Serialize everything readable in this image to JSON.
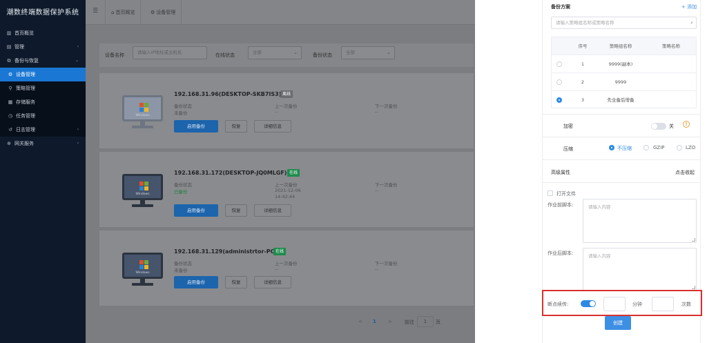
{
  "app": {
    "title": "潮数终端数据保护系统"
  },
  "sidebar": {
    "items": [
      {
        "label": "首页概览",
        "icon": "chart-icon"
      },
      {
        "label": "管理",
        "icon": "grid-icon"
      },
      {
        "label": "备份与恢复",
        "icon": "copy-icon"
      }
    ],
    "sub_items": [
      {
        "label": "设备管理",
        "icon": "gear-icon"
      },
      {
        "label": "策略管理",
        "icon": "strategy-icon"
      },
      {
        "label": "存储服务",
        "icon": "storage-icon"
      },
      {
        "label": "任务管理",
        "icon": "clock-icon"
      },
      {
        "label": "日志管理",
        "icon": "log-icon"
      }
    ],
    "gateway": {
      "label": "网关服务",
      "icon": "gateway-icon"
    }
  },
  "topbar": {
    "tabs": [
      {
        "label": "首页概览"
      },
      {
        "label": "设备管理"
      }
    ]
  },
  "filter": {
    "device_name_label": "设备名称",
    "device_name_placeholder": "请输入IP地址或主机名",
    "online_label": "在线状态",
    "online_value": "全部",
    "backup_label": "备份状态",
    "backup_value": "全部"
  },
  "devices": [
    {
      "title": "192.168.31.96(DESKTOP-SKB7IS3)",
      "status": "离线",
      "online": false,
      "backup_status_label": "备份状态",
      "backup_status": "未备份",
      "last_label": "上一次备份",
      "last_value": "--",
      "last_time": "",
      "next_label": "下一次备份",
      "next_value": "--"
    },
    {
      "title": "192.168.31.172(DESKTOP-JQ0MLGF)",
      "status": "在线",
      "online": true,
      "backup_status_label": "备份状态",
      "backup_status": "已备份",
      "last_label": "上一次备份",
      "last_value": "2021-12-06",
      "last_time": "14:42:44",
      "next_label": "下一次备份",
      "next_value": "--"
    },
    {
      "title": "192.168.31.129(administrtor-PC)",
      "status": "在线",
      "online": true,
      "backup_status_label": "备份状态",
      "backup_status": "未备份",
      "last_label": "上一次备份",
      "last_value": "--",
      "last_time": "",
      "next_label": "下一次备份",
      "next_value": "--"
    }
  ],
  "device_buttons": {
    "enable": "启用备份",
    "restore": "恢复",
    "details": "详细信息"
  },
  "monitor_text": "Windows",
  "pagination": {
    "current": "1",
    "goto_label": "前往",
    "goto_value": "1",
    "page_unit": "页",
    "prev": "<",
    "next": ">"
  },
  "panel": {
    "backup_plan_label": "备份方案",
    "add_link": "+ 添加",
    "search_placeholder": "请输入策略组名称或策略名称",
    "table": {
      "headers": [
        "序号",
        "策略组名称",
        "策略名称"
      ],
      "rows": [
        {
          "index": "1",
          "group": "9999(副本)",
          "name": "",
          "selected": false
        },
        {
          "index": "2",
          "group": "9999",
          "name": "",
          "selected": false
        },
        {
          "index": "3",
          "group": "先全备后增备",
          "name": "",
          "selected": true
        }
      ]
    },
    "encrypt_label": "加密",
    "encrypt_state": "关",
    "compress_label": "压缩",
    "compress_options": [
      {
        "label": "不压缩",
        "selected": true
      },
      {
        "label": "GZIP",
        "selected": false
      },
      {
        "label": "LZO",
        "selected": false
      }
    ],
    "advanced_label": "高级属性",
    "collapse_link": "点击收起",
    "open_file_label": "打开文件",
    "pre_script_label": "作业前脚本:",
    "pre_script_placeholder": "请输入内容",
    "post_script_label": "作业后脚本:",
    "post_script_placeholder": "请输入内容",
    "resume_label": "断点续传:",
    "resume_on": true,
    "minutes_unit": "分钟",
    "times_unit": "次数",
    "create_button": "创建"
  },
  "colors": {
    "accent": "#2d8ae3",
    "sidebar_bg": "#0e1a2b",
    "highlight": "#d9302c",
    "online": "#1e8b4d"
  }
}
